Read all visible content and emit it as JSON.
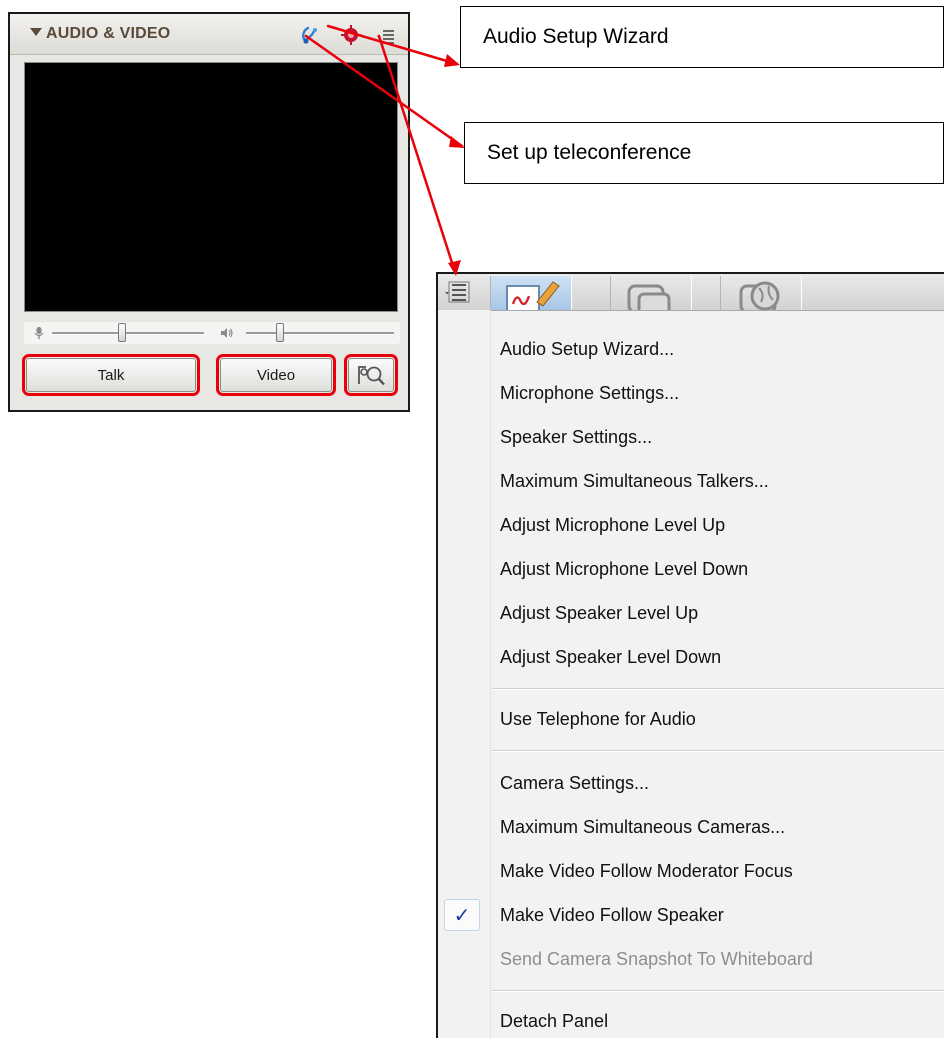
{
  "panel": {
    "title": "AUDIO & VIDEO",
    "talk_label": "Talk",
    "video_label": "Video"
  },
  "callouts": {
    "wizard": "Audio Setup Wizard",
    "teleconference": "Set up teleconference"
  },
  "menu": {
    "items": [
      {
        "label": "Audio Setup Wizard..."
      },
      {
        "label": "Microphone Settings..."
      },
      {
        "label": "Speaker Settings..."
      },
      {
        "label": "Maximum Simultaneous Talkers..."
      },
      {
        "label": "Adjust Microphone Level Up"
      },
      {
        "label": "Adjust Microphone Level Down"
      },
      {
        "label": "Adjust Speaker Level Up"
      },
      {
        "label": "Adjust Speaker Level Down"
      },
      {
        "label": "Use Telephone for Audio"
      },
      {
        "label": "Camera Settings..."
      },
      {
        "label": "Maximum Simultaneous Cameras..."
      },
      {
        "label": "Make Video Follow Moderator Focus"
      },
      {
        "label": "Make Video Follow Speaker",
        "checked": true
      },
      {
        "label": "Send Camera Snapshot To Whiteboard",
        "disabled": true
      },
      {
        "label": "Detach Panel"
      }
    ],
    "check_glyph": "✓"
  },
  "controls": {
    "mic_level": 0.44,
    "speaker_level": 0.2
  },
  "colors": {
    "highlight": "#e8000b",
    "header_text": "#5a4a3a",
    "video_bg": "#000000",
    "check": "#1b3f9c"
  },
  "icons": {
    "caret": "triangle-down-icon",
    "setup": "audio-setup-wizard-icon",
    "teleconference": "teleconference-icon",
    "menu": "panel-menu-icon",
    "mic": "microphone-icon",
    "speaker": "speaker-icon",
    "find": "find-participant-icon"
  }
}
